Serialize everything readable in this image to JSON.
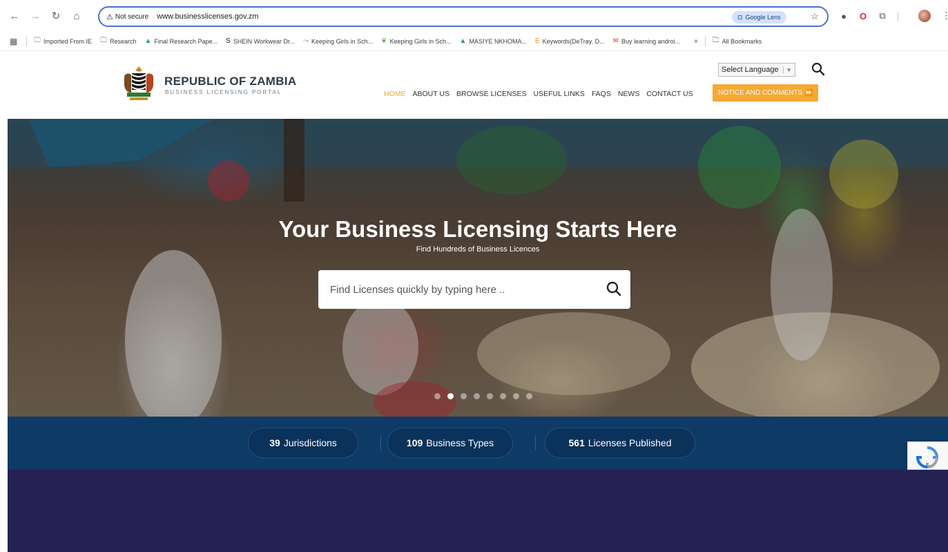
{
  "browser": {
    "security_label": "Not secure",
    "url": "www.businesslicenses.gov.zm",
    "lens_label": "Google Lens",
    "bookmarks": [
      {
        "label": "Imported From IE",
        "icon": "folder-icon"
      },
      {
        "label": "Research",
        "icon": "folder-icon"
      },
      {
        "label": "Final Research Pape...",
        "icon": "drive-icon"
      },
      {
        "label": "SHEIN Workwear Dr...",
        "icon": "shein-icon"
      },
      {
        "label": "Keeping Girls in Sch...",
        "icon": "link-icon"
      },
      {
        "label": "Keeping Girls in Sch...",
        "icon": "leaf-icon"
      },
      {
        "label": "MASIYE NKHOMA...",
        "icon": "drive-icon"
      },
      {
        "label": "Keywords(DeTray, D...",
        "icon": "e-icon"
      },
      {
        "label": "Buy learning androi...",
        "icon": "gmail-icon"
      }
    ],
    "more_label": "»",
    "all_bookmarks": "All Bookmarks"
  },
  "site": {
    "brand_title": "REPUBLIC OF ZAMBIA",
    "brand_subtitle": "BUSINESS LICENSING PORTAL",
    "language_select": "Select Language",
    "nav": [
      "HOME",
      "ABOUT US",
      "BROWSE LICENSES",
      "USEFUL LINKS",
      "FAQS",
      "NEWS",
      "CONTACT US"
    ],
    "notice_button": "NOTICE AND COMMENTS ⏩"
  },
  "hero": {
    "title": "Your Business Licensing Starts Here",
    "subtitle": "Find Hundreds of Business Licences",
    "search_placeholder": "Find Licenses quickly by typing here ..",
    "slide_count": 8,
    "active_slide": 2
  },
  "stats": [
    {
      "number": "39",
      "label": "Jurisdictions"
    },
    {
      "number": "109",
      "label": "Business Types"
    },
    {
      "number": "561",
      "label": "Licenses Published"
    }
  ],
  "colors": {
    "accent_orange": "#f6a934",
    "stats_bg": "#0e3a66",
    "lower_bg": "#262254"
  }
}
